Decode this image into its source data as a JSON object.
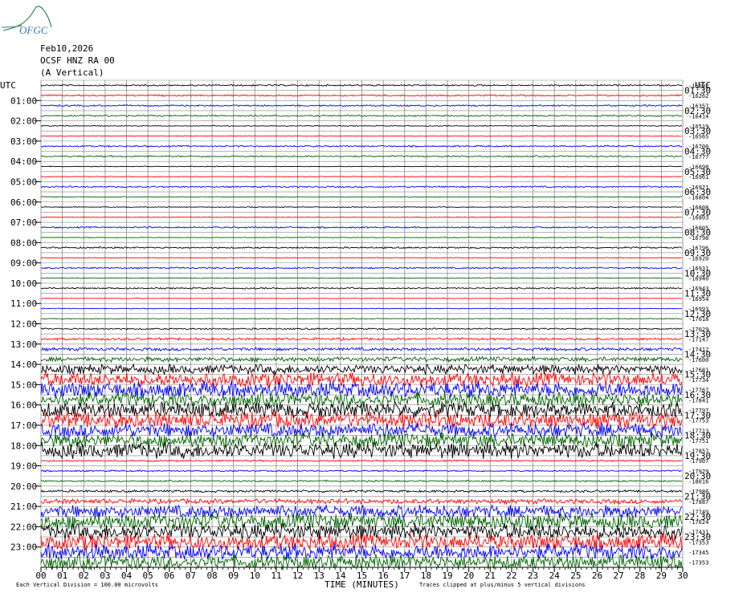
{
  "header": {
    "date": "Feb10,2026",
    "station": "OCSF HNZ RA 00",
    "component": "(A Vertical)",
    "logo_text": "OFGC"
  },
  "chart_data": {
    "type": "line",
    "title": "Feb10,2026",
    "xlabel": "TIME (MINUTES)",
    "ylabel": "UTC",
    "left_axis_title": "UTC",
    "right_axis_title": "UTC",
    "x_ticks": [
      "00",
      "01",
      "02",
      "03",
      "04",
      "05",
      "06",
      "07",
      "08",
      "09",
      "10",
      "11",
      "12",
      "13",
      "14",
      "15",
      "16",
      "17",
      "18",
      "19",
      "20",
      "21",
      "22",
      "23",
      "24",
      "25",
      "26",
      "27",
      "28",
      "29",
      "30"
    ],
    "xlim": [
      0,
      30
    ],
    "grid": true,
    "trace_colors": [
      "#000000",
      "#ff0000",
      "#0000ff",
      "#006400"
    ],
    "left_hour_labels": [
      "01:00",
      "02:00",
      "03:00",
      "04:00",
      "05:00",
      "06:00",
      "07:00",
      "08:00",
      "09:00",
      "10:00",
      "11:00",
      "12:00",
      "13:00",
      "14:00",
      "15:00",
      "16:00",
      "17:00",
      "18:00",
      "19:00",
      "20:00",
      "21:00",
      "22:00",
      "23:00"
    ],
    "right_hour_labels": [
      "01:30",
      "02:30",
      "03:30",
      "04:30",
      "05:30",
      "06:30",
      "07:30",
      "08:30",
      "09:30",
      "10:30",
      "11:30",
      "12:30",
      "13:30",
      "14:30",
      "15:30",
      "16:30",
      "17:30",
      "18:30",
      "19:30",
      "20:30",
      "21:30",
      "22:30",
      "23:30"
    ],
    "trace_offsets": [
      "-16092",
      "-16262",
      "-16357",
      "-16414",
      "-16519",
      "-16565",
      "-16700",
      "-16777",
      "-16898",
      "-16961",
      "-16971",
      "-16804",
      "-16808",
      "-16803",
      "-16805",
      "-16798",
      "-16796",
      "-16920",
      "-16931",
      "-16940",
      "-16943",
      "-16954",
      "-16993",
      "-17018",
      "-17029",
      "-17147",
      "-17412",
      "-17600",
      "-17681",
      "-17734",
      "-17767",
      "-17841",
      "-17797",
      "-17753",
      "-17713",
      "-17751",
      "-17857",
      "-17907",
      "-17979",
      "-18016",
      "-17986",
      "-17887",
      "-17749",
      "-17624",
      "-17431",
      "-17353",
      "-17345",
      "-17353"
    ],
    "trace_amplitude": [
      0.1,
      0.1,
      0.1,
      0.1,
      0.05,
      0.05,
      0.1,
      0.1,
      0.05,
      0.05,
      0.1,
      0.05,
      0.05,
      0.05,
      0.1,
      0.05,
      0.1,
      0.05,
      0.1,
      0.05,
      0.1,
      0.05,
      0.05,
      0.05,
      0.1,
      0.15,
      0.2,
      0.3,
      0.6,
      0.9,
      1.0,
      0.9,
      1.0,
      1.0,
      0.9,
      0.9,
      1.0,
      0.1,
      0.1,
      0.1,
      0.15,
      0.3,
      0.8,
      1.0,
      1.0,
      1.0,
      1.0,
      0.9
    ],
    "footer_left": "Each Vertical Division = 100.00 microvolts",
    "footer_right": "Traces clipped at plus/minus 5 vertical divisions"
  }
}
